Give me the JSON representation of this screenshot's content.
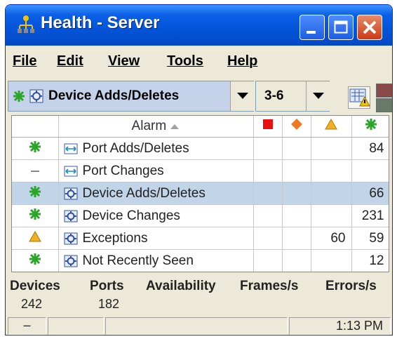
{
  "window": {
    "title": "Health - Server",
    "icon": "network-health-icon"
  },
  "menu": [
    "File",
    "Edit",
    "View",
    "Tools",
    "Help"
  ],
  "toolbar": {
    "scope": "Device Adds/Deletes",
    "range": "3-6"
  },
  "table": {
    "headers": {
      "alarm": "Alarm",
      "sort_icon": "sort-ascending-icon",
      "critical_icon": "red-square-icon",
      "major_icon": "orange-diamond-icon",
      "minor_icon": "yellow-triangle-icon",
      "ok_icon": "green-star-icon"
    },
    "rows": [
      {
        "status": "ok",
        "icon": "port-icon",
        "alarm": "Port Adds/Deletes",
        "critical": "",
        "major": "",
        "minor": "",
        "ok": "84",
        "selected": false
      },
      {
        "status": "none",
        "icon": "port-icon",
        "alarm": "Port Changes",
        "critical": "",
        "major": "",
        "minor": "",
        "ok": "",
        "selected": false
      },
      {
        "status": "ok",
        "icon": "device-icon",
        "alarm": "Device Adds/Deletes",
        "critical": "",
        "major": "",
        "minor": "",
        "ok": "66",
        "selected": true
      },
      {
        "status": "ok",
        "icon": "device-icon",
        "alarm": "Device Changes",
        "critical": "",
        "major": "",
        "minor": "",
        "ok": "231",
        "selected": false
      },
      {
        "status": "warning",
        "icon": "device-icon",
        "alarm": "Exceptions",
        "critical": "",
        "major": "",
        "minor": "60",
        "ok": "59",
        "selected": false
      },
      {
        "status": "ok",
        "icon": "device-icon",
        "alarm": "Not Recently Seen",
        "critical": "",
        "major": "",
        "minor": "",
        "ok": "12",
        "selected": false
      }
    ]
  },
  "stats": {
    "devices_label": "Devices",
    "devices": "242",
    "ports_label": "Ports",
    "ports": "182",
    "availability_label": "Availability",
    "frames_label": "Frames/s",
    "errors_label": "Errors/s"
  },
  "statusbar": {
    "indicator": "–",
    "time": "1:13 PM"
  },
  "colors": {
    "titlebar": "#0454d9",
    "selected_row": "#c2d4e8",
    "ok": "#2aa52a",
    "critical": "#e81010",
    "major": "#f07820",
    "minor": "#f0b020"
  }
}
